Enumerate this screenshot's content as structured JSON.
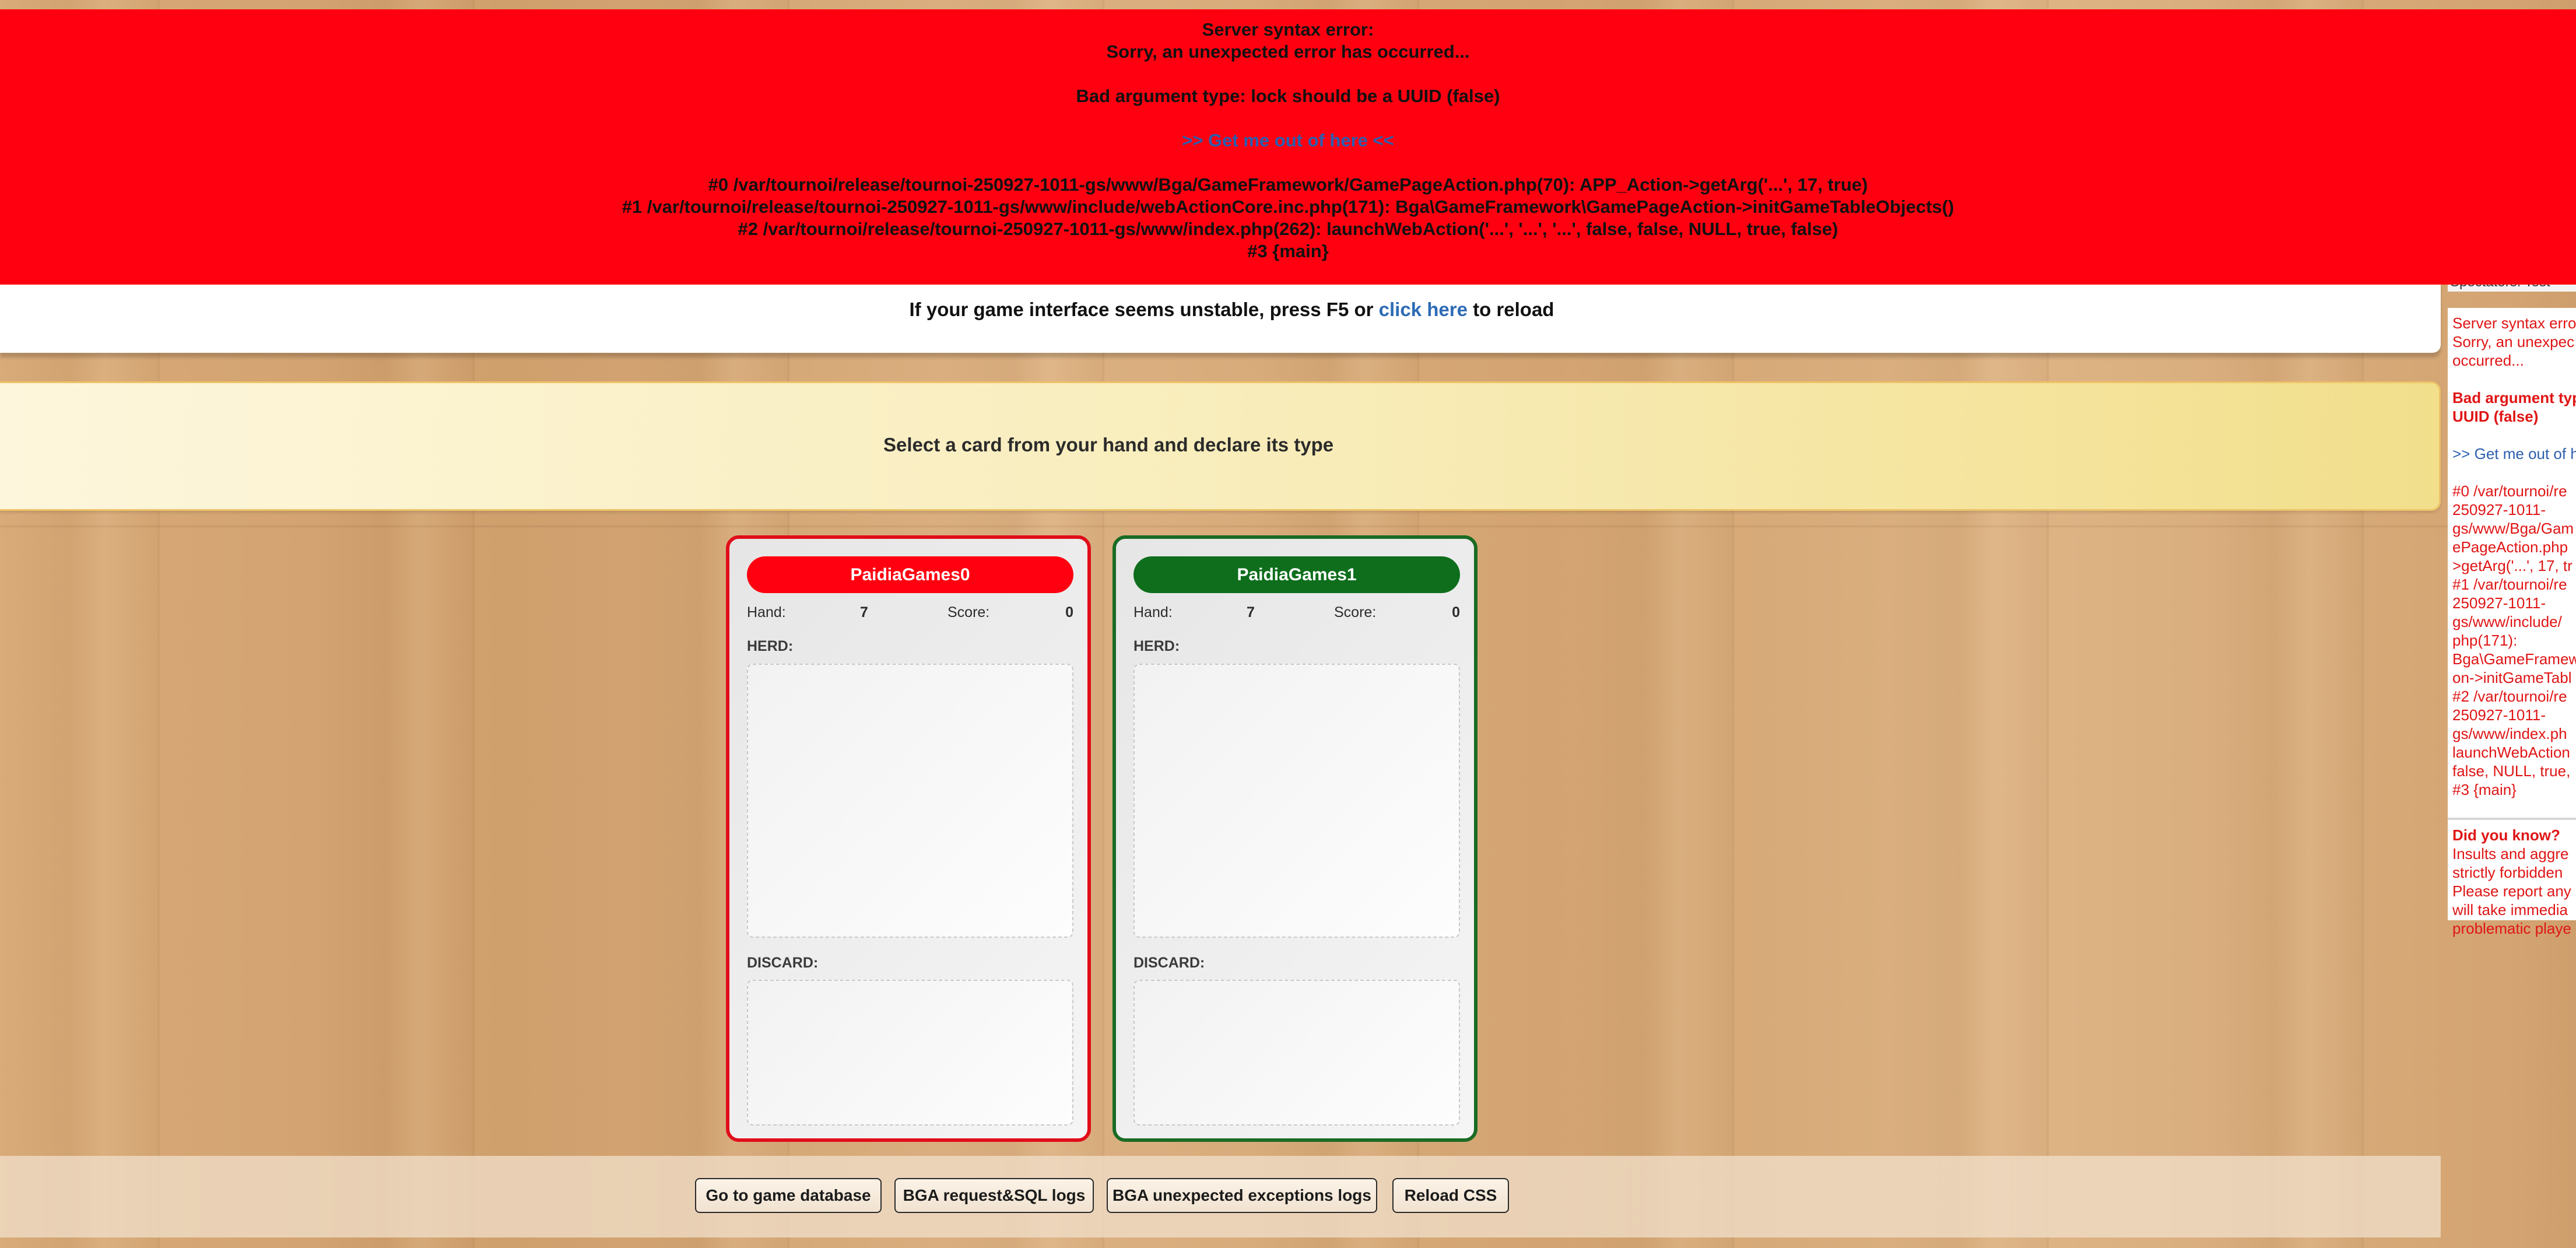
{
  "error_banner": {
    "title": "Server syntax error:",
    "subtitle": "Sorry, an unexpected error has occurred...",
    "message": "Bad argument type: lock should be a UUID (false)",
    "link": ">> Get me out of here <<",
    "trace": [
      "#0 /var/tournoi/release/tournoi-250927-1011-gs/www/Bga/GameFramework/GamePageAction.php(70): APP_Action->getArg('...', 17, true)",
      "#1 /var/tournoi/release/tournoi-250927-1011-gs/www/include/webActionCore.inc.php(171): Bga\\GameFramework\\GamePageAction->initGameTableObjects()",
      "#2 /var/tournoi/release/tournoi-250927-1011-gs/www/index.php(262): launchWebAction('...', '...', '...', false, false, NULL, true, false)",
      "#3 {main}"
    ]
  },
  "reload": {
    "prefix": "If your game interface seems unstable, press F5 or ",
    "link": "click here",
    "suffix": " to reload"
  },
  "status": {
    "text": "Select a card from your hand and declare its type"
  },
  "players": [
    {
      "name": "PaidiaGames0",
      "color": "#ff0010",
      "hand_label": "Hand:",
      "hand": "7",
      "score_label": "Score:",
      "score": "0",
      "herd_label": "HERD:",
      "discard_label": "DISCARD:"
    },
    {
      "name": "PaidiaGames1",
      "color": "#0e6e1c",
      "hand_label": "Hand:",
      "hand": "7",
      "score_label": "Score:",
      "score": "0",
      "herd_label": "HERD:",
      "discard_label": "DISCARD:"
    }
  ],
  "debug_toolbar": {
    "buttons": [
      "Go to game database",
      "BGA request&SQL logs",
      "BGA unexpected exceptions logs",
      "Reload CSS"
    ]
  },
  "sidebar": {
    "spectators": "Spectators:    Test",
    "error_lines": [
      "Server syntax erro",
      "Sorry, an unexpec",
      "occurred..."
    ],
    "bad_arg_lines": [
      "Bad argument typ",
      "UUID (false)"
    ],
    "link": ">> Get me out of h",
    "trace_lines": [
      "#0 /var/tournoi/re",
      "250927-1011-",
      "gs/www/Bga/Gam",
      "ePageAction.php",
      ">getArg('...', 17, tr",
      "#1 /var/tournoi/re",
      "250927-1011-",
      "gs/www/include/",
      "php(171):",
      "Bga\\GameFramew",
      "on->initGameTabl",
      "#2 /var/tournoi/re",
      "250927-1011-",
      "gs/www/index.ph",
      "launchWebAction",
      "false, NULL, true,",
      "#3 {main}"
    ],
    "did_you_know_title": "Did you know?",
    "did_you_know_lines": [
      "Insults and aggre",
      "strictly forbidden",
      "Please report any",
      "will take immedia",
      "problematic playe"
    ]
  }
}
